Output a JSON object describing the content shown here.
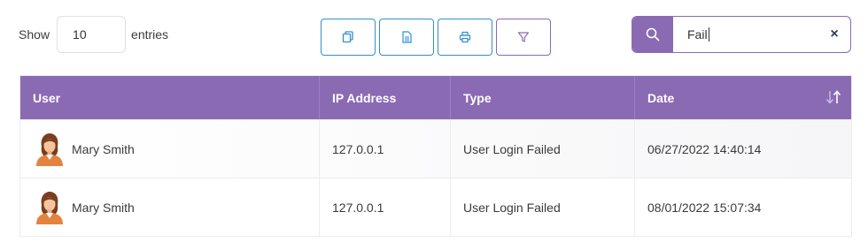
{
  "length_control": {
    "prefix": "Show",
    "value": "10",
    "suffix": "entries"
  },
  "toolbar": {
    "buttons": [
      {
        "icon": "copy-icon"
      },
      {
        "icon": "document-icon"
      },
      {
        "icon": "print-icon"
      },
      {
        "icon": "filter-icon"
      }
    ]
  },
  "search": {
    "value": "Fail",
    "clear_label": "×",
    "icon": "search-icon"
  },
  "table": {
    "columns": [
      "User",
      "IP Address",
      "Type",
      "Date"
    ],
    "rows": [
      {
        "user": "Mary Smith",
        "ip": "127.0.0.1",
        "type": "User Login Failed",
        "date": "06/27/2022 14:40:14"
      },
      {
        "user": "Mary Smith",
        "ip": "127.0.0.1",
        "type": "User Login Failed",
        "date": "08/01/2022 15:07:34"
      }
    ]
  },
  "colors": {
    "accent": "#8b6ab4",
    "button_border": "#2e8fd1"
  }
}
